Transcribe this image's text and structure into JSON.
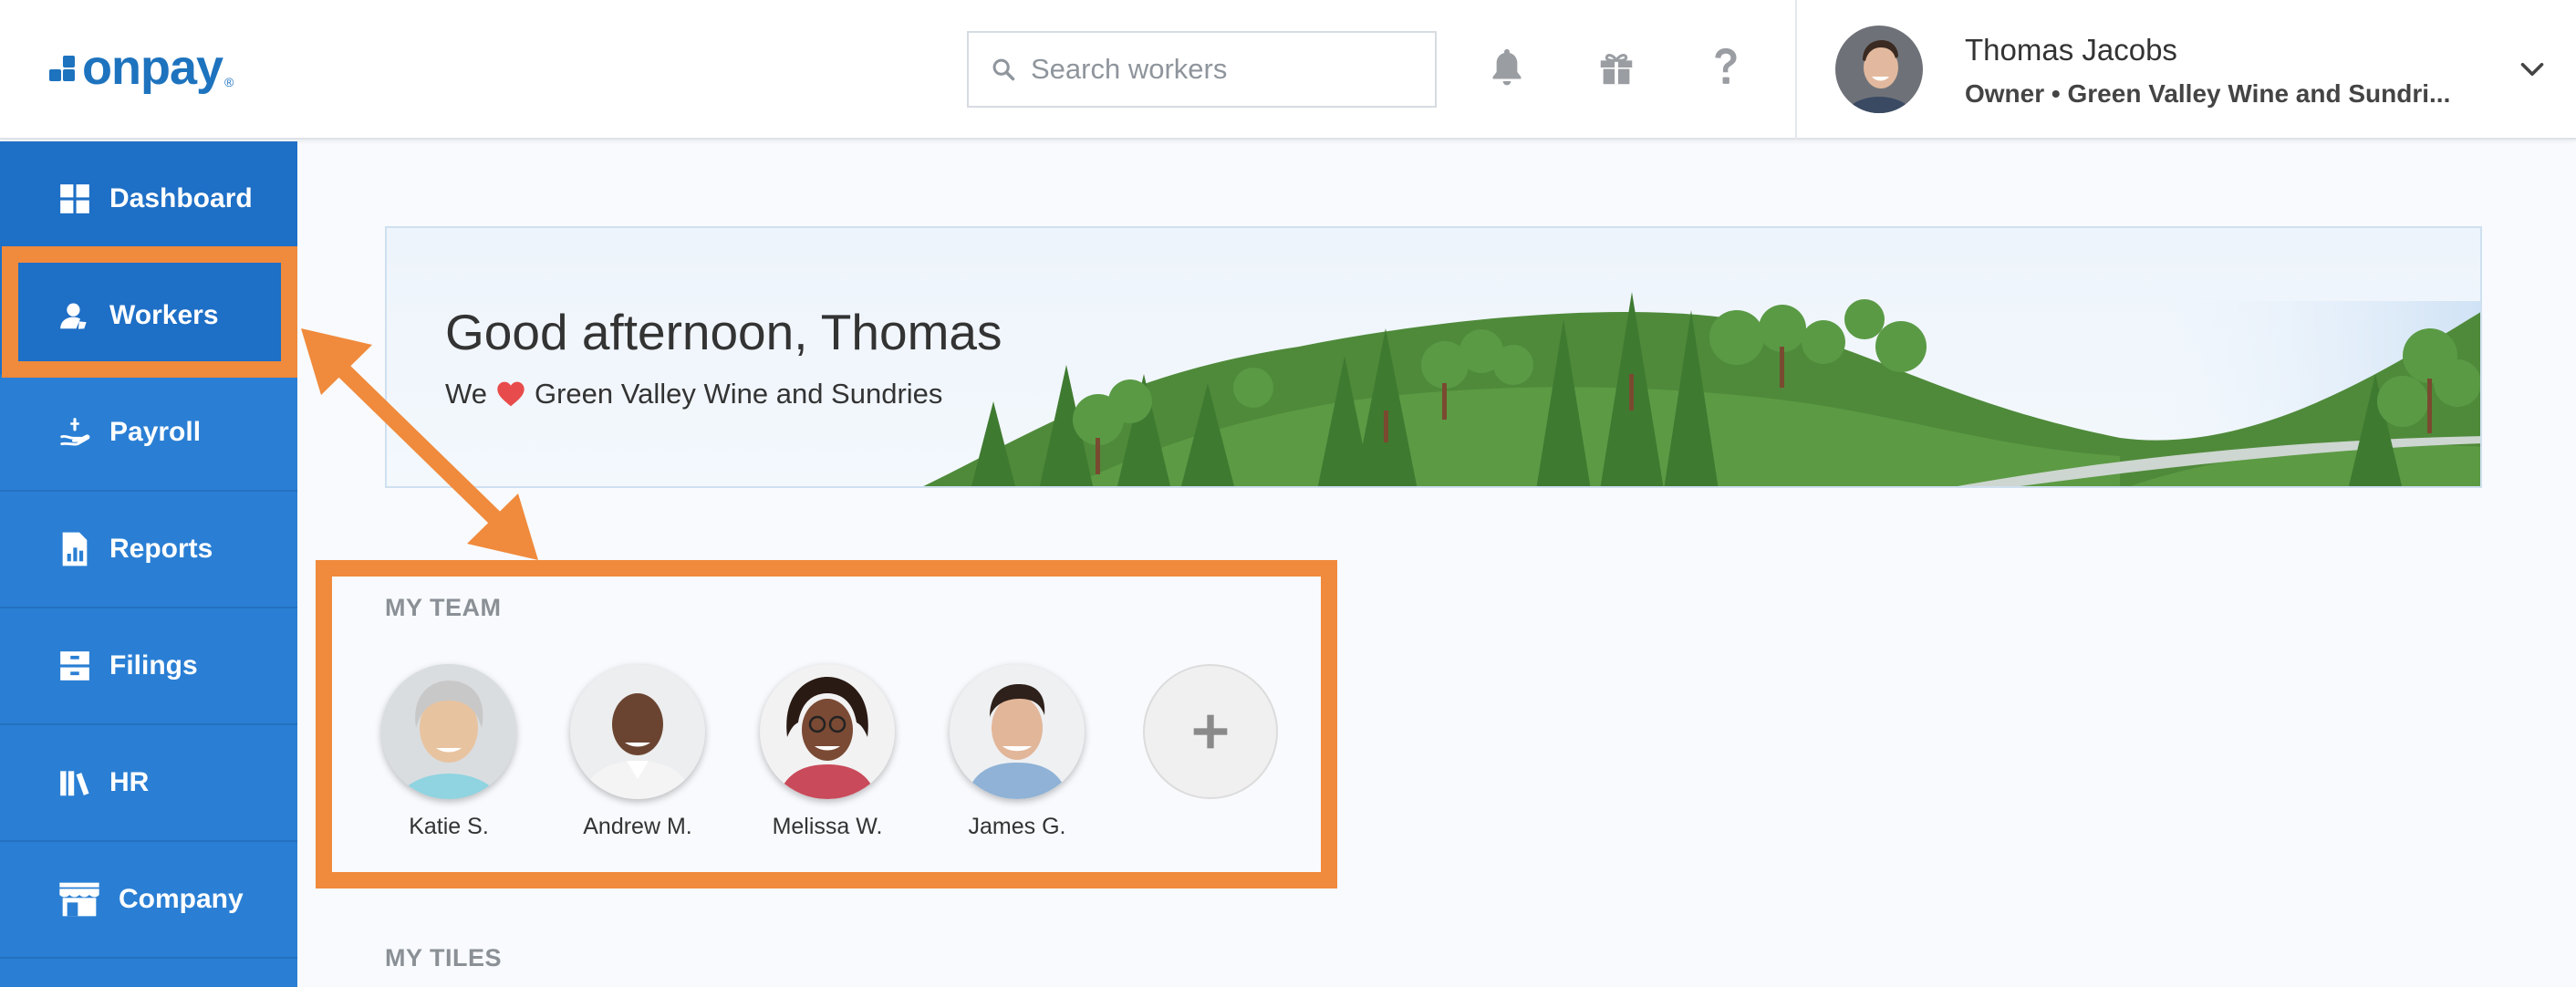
{
  "header": {
    "logo_text": "onpay",
    "logo_mark": "®",
    "search_placeholder": "Search workers",
    "icons": [
      "search-icon",
      "bell-icon",
      "gift-icon",
      "help-icon",
      "chevron-down-icon"
    ],
    "user": {
      "name": "Thomas Jacobs",
      "role": "Owner • Green Valley Wine and Sundri..."
    }
  },
  "sidebar": {
    "items": [
      {
        "label": "Dashboard",
        "icon": "dashboard-icon"
      },
      {
        "label": "Workers",
        "icon": "workers-icon"
      },
      {
        "label": "Payroll",
        "icon": "payroll-icon"
      },
      {
        "label": "Reports",
        "icon": "reports-icon"
      },
      {
        "label": "Filings",
        "icon": "filings-icon"
      },
      {
        "label": "HR",
        "icon": "hr-icon"
      },
      {
        "label": "Company",
        "icon": "company-icon"
      }
    ]
  },
  "banner": {
    "greeting": "Good afternoon, Thomas",
    "sub_prefix": "We",
    "sub_company": "Green Valley Wine and Sundries"
  },
  "team": {
    "label": "MY TEAM",
    "members": [
      {
        "name": "Katie S."
      },
      {
        "name": "Andrew M."
      },
      {
        "name": "Melissa W."
      },
      {
        "name": "James G."
      }
    ]
  },
  "tiles": {
    "label": "MY TILES"
  },
  "colors": {
    "brand": "#1e73be",
    "sidebar": "#2a7fd4",
    "annotation": "#f08a3c",
    "heart": "#e84b4b"
  }
}
